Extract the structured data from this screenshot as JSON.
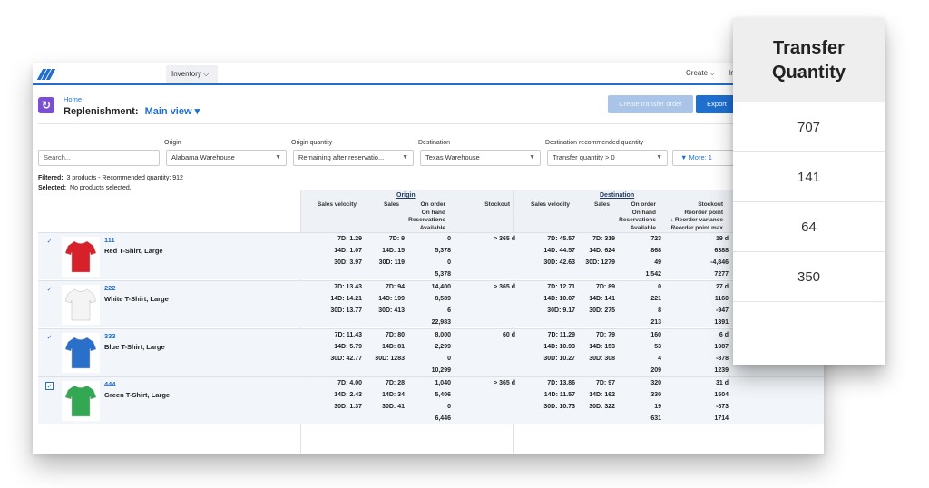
{
  "nav": {
    "tab": "Inventory",
    "create": "Create",
    "more": "In"
  },
  "header": {
    "breadcrumb": "Home",
    "title": "Replenishment:",
    "view": "Main view",
    "btn_transfer": "Create transfer order",
    "btn_export": "Export"
  },
  "filters": {
    "search_placeholder": "Search...",
    "origin_label": "Origin",
    "origin_value": "Alabama Warehouse",
    "origin_qty_label": "Origin quantity",
    "origin_qty_value": "Remaining after reservatio...",
    "dest_label": "Destination",
    "dest_value": "Texas Warehouse",
    "dest_qty_label": "Destination recommended quantity",
    "dest_qty_value": "Transfer quantity > 0",
    "more": "More: 1"
  },
  "meta": {
    "filtered_label": "Filtered:",
    "filtered_value": "3 products - Recommended quantity: 912",
    "selected_label": "Selected:",
    "selected_value": "No products selected."
  },
  "table": {
    "group_origin": "Origin",
    "group_destination": "Destination",
    "h_sales_velocity": "Sales velocity",
    "h_sales": "Sales",
    "h_onorder": "On order",
    "h_onhand": "On hand",
    "h_reservations": "Reservations",
    "h_available": "Available",
    "h_stockout": "Stockout",
    "h_d_sales_velocity": "Sales velocity",
    "h_d_sales": "Sales",
    "h_d_onorder": "On order",
    "h_d_onhand": "On hand",
    "h_d_reservations": "Reservations",
    "h_d_available": "Available",
    "h_d_stockout": "Stockout",
    "h_reorder_point": "Reorder point",
    "h_reorder_variance": "↓ Reorder variance",
    "h_reorder_max": "Reorder point max",
    "rows": [
      {
        "check": "✓",
        "id": "111",
        "name": "Red T-Shirt, Large",
        "color": "#d8202a",
        "sv": [
          "7D: 1.29",
          "14D: 1.07",
          "30D: 3.97"
        ],
        "s": [
          "7D: 9",
          "14D: 15",
          "30D: 119"
        ],
        "oq": [
          "0",
          "5,378",
          "0",
          "5,378"
        ],
        "stockout": "> 365 d",
        "dsv": [
          "7D: 45.57",
          "14D: 44.57",
          "30D: 42.63"
        ],
        "ds": [
          "7D: 319",
          "14D: 624",
          "30D: 1279"
        ],
        "dq": [
          "723",
          "868",
          "49",
          "1,542"
        ],
        "dr": [
          "19 d",
          "6388",
          "-4,846",
          "7277"
        ]
      },
      {
        "check": "✓",
        "id": "222",
        "name": "White T-Shirt, Large",
        "color": "#f4f4f4",
        "sv": [
          "7D: 13.43",
          "14D: 14.21",
          "30D: 13.77"
        ],
        "s": [
          "7D: 94",
          "14D: 199",
          "30D: 413"
        ],
        "oq": [
          "14,400",
          "8,589",
          "6",
          "22,983"
        ],
        "stockout": "> 365 d",
        "dsv": [
          "7D: 12.71",
          "14D: 10.07",
          "30D: 9.17"
        ],
        "ds": [
          "7D: 89",
          "14D: 141",
          "30D: 275"
        ],
        "dq": [
          "0",
          "221",
          "8",
          "213"
        ],
        "dr": [
          "27 d",
          "1160",
          "-947",
          "1391"
        ]
      },
      {
        "check": "✓",
        "id": "333",
        "name": "Blue T-Shirt, Large",
        "color": "#2a6fc9",
        "sv": [
          "7D: 11.43",
          "14D: 5.79",
          "30D: 42.77"
        ],
        "s": [
          "7D: 80",
          "14D: 81",
          "30D: 1283"
        ],
        "oq": [
          "8,000",
          "2,299",
          "0",
          "10,299"
        ],
        "stockout": "60 d",
        "dsv": [
          "7D: 11.29",
          "14D: 10.93",
          "30D: 10.27"
        ],
        "ds": [
          "7D: 79",
          "14D: 153",
          "30D: 308"
        ],
        "dq": [
          "160",
          "53",
          "4",
          "209"
        ],
        "dr": [
          "6 d",
          "1087",
          "-878",
          "1239"
        ]
      },
      {
        "check": "✓",
        "id": "444",
        "name": "Green T-Shirt, Large",
        "color": "#33a852",
        "sv": [
          "7D: 4.00",
          "14D: 2.43",
          "30D: 1.37"
        ],
        "s": [
          "7D: 28",
          "14D: 34",
          "30D: 41"
        ],
        "oq": [
          "1,040",
          "5,406",
          "0",
          "6,446"
        ],
        "stockout": "> 365 d",
        "dsv": [
          "7D: 13.86",
          "14D: 11.57",
          "30D: 10.73"
        ],
        "ds": [
          "7D: 97",
          "14D: 162",
          "30D: 322"
        ],
        "dq": [
          "320",
          "330",
          "19",
          "631"
        ],
        "dr": [
          "31 d",
          "1504",
          "-873",
          "1714"
        ]
      }
    ]
  },
  "card": {
    "title_line1": "Transfer",
    "title_line2": "Quantity",
    "values": [
      "707",
      "141",
      "64",
      "350"
    ]
  }
}
